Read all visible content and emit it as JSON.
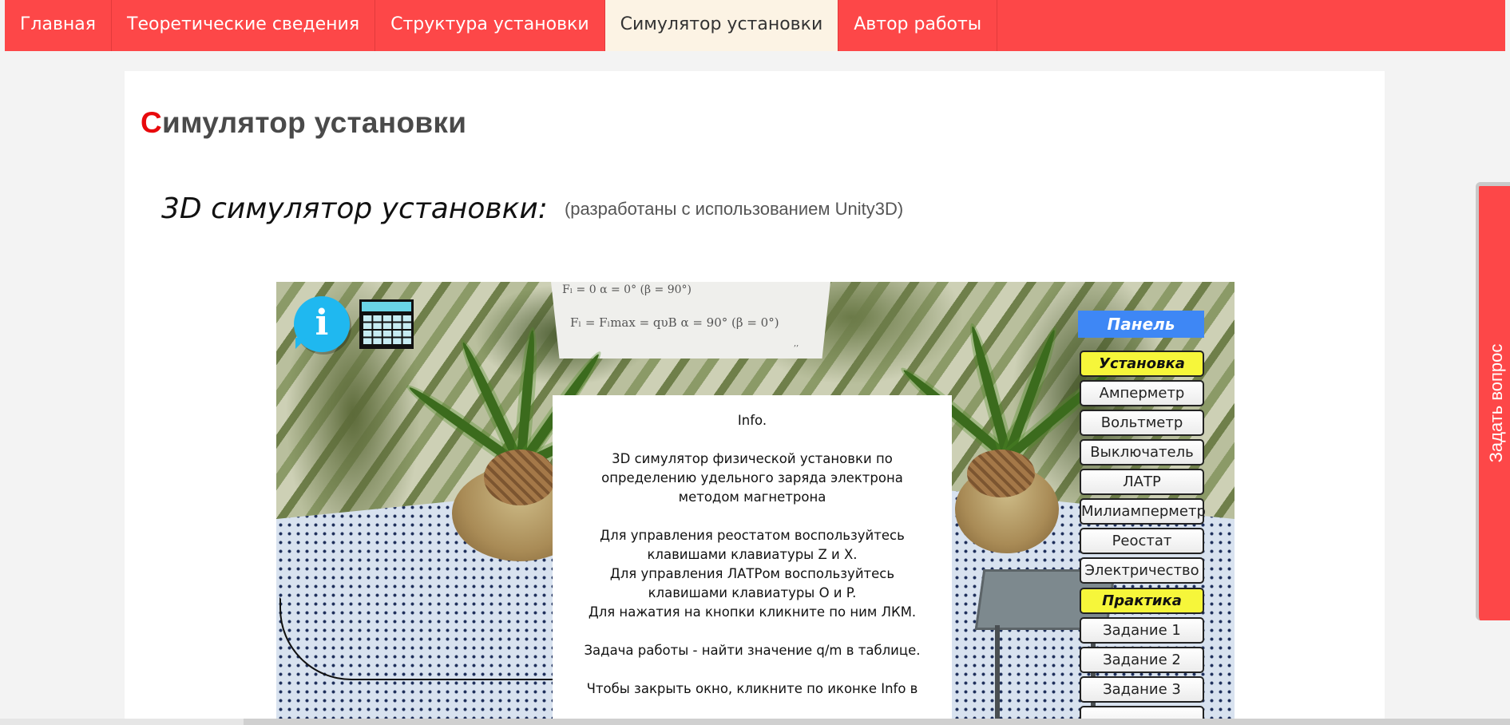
{
  "nav": {
    "items": [
      {
        "label": "Главная"
      },
      {
        "label": "Теоретические сведения"
      },
      {
        "label": "Структура установки"
      },
      {
        "label": "Симулятор установки"
      },
      {
        "label": "Автор работы"
      }
    ],
    "active_index": 3
  },
  "page": {
    "title_first_letter": "С",
    "title_rest": "имулятор установки",
    "subtitle": "3D симулятор установки:",
    "subtitle_note": "(разработаны с использованием Unity3D)"
  },
  "simulator": {
    "formulas": {
      "line1": "Fₗ = 0   α = 0°   (β = 90°)",
      "line2": "Fₗ = Fₗmax = qυB   α = 90°   (β = 0°)"
    },
    "info_icon_glyph": "i",
    "icons": [
      "info-icon",
      "table-icon"
    ],
    "info_dialog": {
      "title": "Info.",
      "paragraph1": [
        "3D симулятор физической установки по",
        "определению удельного заряда электрона",
        "методом магнетрона"
      ],
      "paragraph2": [
        "Для управления реостатом воспользуйтесь",
        "клавишами клавиатуры Z и X.",
        "Для управления ЛАТРом воспользуйтесь",
        "клавишами клавиатуры O и P.",
        "Для нажатия на кнопки кликните по ним ЛКМ."
      ],
      "paragraph3": "Задача работы - найти значение q/m в таблице.",
      "paragraph4": "Чтобы закрыть окно, кликните по иконке Info в"
    },
    "panel": {
      "header": "Панель",
      "section_setup": "Установка",
      "setup_buttons": [
        "Амперметр",
        "Вольтметр",
        "Выключатель",
        "ЛАТР",
        "Милиамперметр",
        "Реостат",
        "Электричество"
      ],
      "section_practice": "Практика",
      "practice_buttons": [
        "Задание 1",
        "Задание 2",
        "Задание 3"
      ]
    }
  },
  "ask_tab": {
    "label": "Задать вопрос"
  },
  "colors": {
    "nav_bg": "#fd4748",
    "nav_active_bg": "#fcf3e4",
    "title_accent": "#e8090c",
    "panel_header": "#3e87f5",
    "panel_section": "#f6f63a",
    "info_icon": "#1fb8f0"
  }
}
